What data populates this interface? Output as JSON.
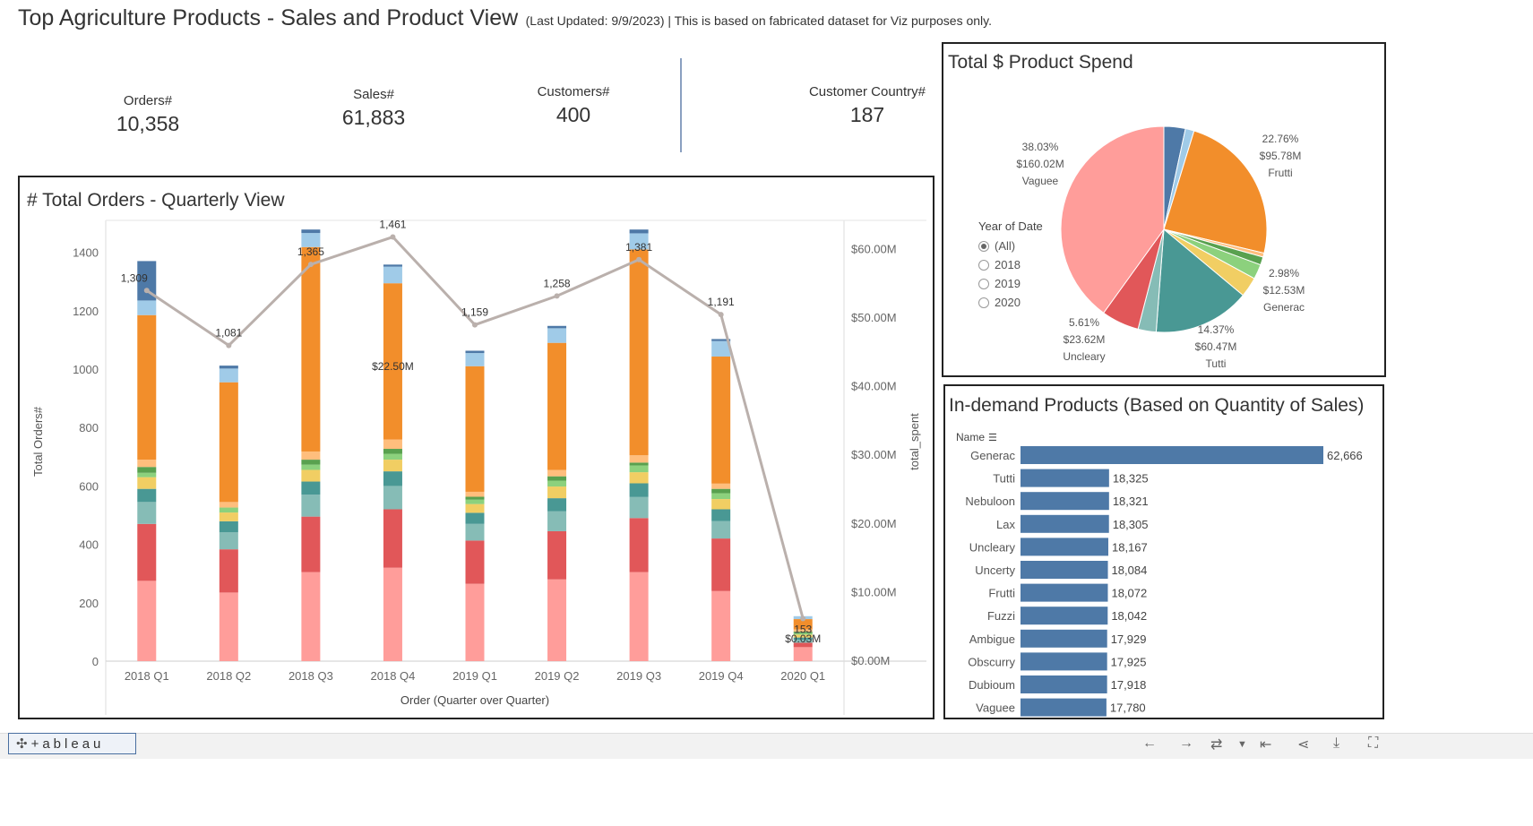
{
  "header": {
    "title": "Top Agriculture Products - Sales and Product View",
    "subtitle": "(Last Updated: 9/9/2023) | This is based on fabricated dataset for Viz purposes only."
  },
  "kpis": [
    {
      "label": "Orders#",
      "value": "10,358"
    },
    {
      "label": "Sales#",
      "value": "61,883"
    },
    {
      "label": "Customers#",
      "value": "400"
    },
    {
      "label": "Customer Country#",
      "value": "187"
    }
  ],
  "colors": {
    "blue": "#4e79a7",
    "lightblue": "#a0cbe8",
    "orange": "#f28e2b",
    "lightorange": "#ffbe7d",
    "green": "#59a14f",
    "lightgreen": "#8cd17d",
    "yellow": "#f1ce63",
    "teal": "#499894",
    "lightteal": "#86bcb6",
    "red": "#e15759",
    "pink": "#ff9d9a",
    "line": "#bab0ac",
    "bar": "#4e79a7"
  },
  "chart_data": [
    {
      "type": "bar",
      "title": "# Total Orders - Quarterly View",
      "xlabel": "Order (Quarter over Quarter)",
      "ylabel": "Total Orders#",
      "y2label": "total_spent",
      "ylim": [
        0,
        1500
      ],
      "y2lim": [
        0,
        65000000
      ],
      "yticks": [
        0,
        200,
        400,
        600,
        800,
        1000,
        1200,
        1400
      ],
      "y2ticks": [
        "$0.00M",
        "$10.00M",
        "$20.00M",
        "$30.00M",
        "$40.00M",
        "$50.00M",
        "$60.00M"
      ],
      "categories": [
        "2018 Q1",
        "2018 Q2",
        "2018 Q3",
        "2018 Q4",
        "2019 Q1",
        "2019 Q2",
        "2019 Q3",
        "2019 Q4",
        "2020 Q1"
      ],
      "series_colors": [
        "#ff9d9a",
        "#e15759",
        "#86bcb6",
        "#499894",
        "#f1ce63",
        "#8cd17d",
        "#59a14f",
        "#ffbe7d",
        "#f28e2b",
        "#a0cbe8",
        "#4e79a7"
      ],
      "stacks": [
        [
          275,
          195,
          75,
          45,
          40,
          15,
          20,
          25,
          495,
          50,
          135
        ],
        [
          235,
          148,
          58,
          38,
          30,
          17,
          0,
          19,
          410,
          47,
          10
        ],
        [
          305,
          190,
          75,
          45,
          40,
          18,
          17,
          28,
          700,
          48,
          12
        ],
        [
          320,
          200,
          80,
          50,
          40,
          20,
          17,
          32,
          535,
          57,
          7
        ],
        [
          265,
          148,
          57,
          38,
          30,
          15,
          10,
          17,
          430,
          45,
          8
        ],
        [
          280,
          165,
          68,
          45,
          40,
          20,
          15,
          22,
          435,
          50,
          8
        ],
        [
          305,
          185,
          72,
          47,
          38,
          23,
          10,
          25,
          705,
          55,
          13
        ],
        [
          240,
          180,
          60,
          40,
          35,
          20,
          15,
          18,
          435,
          53,
          7
        ],
        [
          48,
          15,
          10,
          8,
          10,
          5,
          5,
          8,
          35,
          10,
          0
        ]
      ],
      "line": {
        "name": "total_spent",
        "values": [
          54000000,
          46000000,
          57800000,
          61800000,
          49000000,
          53200000,
          58500000,
          50500000,
          6200000
        ],
        "labels": [
          "1,309",
          "1,081",
          "1,365",
          "1,461",
          "1,159",
          "1,258",
          "1,381",
          "1,191",
          "153"
        ]
      },
      "annotations": [
        "$22.50M",
        "$0.03M"
      ]
    },
    {
      "type": "pie",
      "title": "Total $ Product Spend",
      "slices": [
        {
          "value": 3.2,
          "color": "#4e79a7"
        },
        {
          "value": 1.3,
          "color": "#a0cbe8"
        },
        {
          "value": 22.76,
          "color": "#f28e2b",
          "pct": "22.76%",
          "amount": "$95.78M",
          "name": "Frutti"
        },
        {
          "value": 0.6,
          "color": "#ffbe7d"
        },
        {
          "value": 1.2,
          "color": "#59a14f"
        },
        {
          "value": 2.2,
          "color": "#8cd17d"
        },
        {
          "value": 2.98,
          "color": "#f1ce63",
          "pct": "2.98%",
          "amount": "$12.53M",
          "name": "Generac"
        },
        {
          "value": 14.37,
          "color": "#499894",
          "pct": "14.37%",
          "amount": "$60.47M",
          "name": "Tutti"
        },
        {
          "value": 2.7,
          "color": "#86bcb6"
        },
        {
          "value": 5.61,
          "color": "#e15759",
          "pct": "5.61%",
          "amount": "$23.62M",
          "name": "Uncleary"
        },
        {
          "value": 38.03,
          "color": "#ff9d9a",
          "pct": "38.03%",
          "amount": "$160.02M",
          "name": "Vaguee"
        }
      ],
      "legend": {
        "title": "Year of Date",
        "options": [
          "(All)",
          "2018",
          "2019",
          "2020"
        ],
        "selected": "(All)"
      }
    },
    {
      "type": "bar",
      "orientation": "horizontal",
      "title": "In-demand Products (Based on Quantity of Sales)",
      "xlabel": "",
      "ylabel": "Name",
      "categories": [
        "Generac",
        "Tutti",
        "Nebuloon",
        "Lax",
        "Uncleary",
        "Uncerty",
        "Frutti",
        "Fuzzi",
        "Ambigue",
        "Obscurry",
        "Dubioum",
        "Vaguee"
      ],
      "values": [
        62666,
        18325,
        18321,
        18305,
        18167,
        18084,
        18072,
        18042,
        17929,
        17925,
        17918,
        17780
      ],
      "labels": [
        "62,666",
        "18,325",
        "18,321",
        "18,305",
        "18,167",
        "18,084",
        "18,072",
        "18,042",
        "17,929",
        "17,925",
        "17,918",
        "17,780"
      ]
    }
  ],
  "footer": {
    "logo": "+ableau",
    "logo_mark": "✣"
  }
}
